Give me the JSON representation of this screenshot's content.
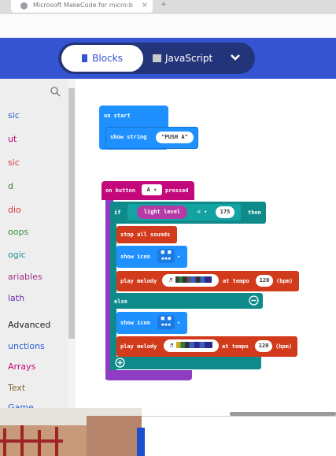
{
  "browser": {
    "tab_title": "Microsoft MakeCode for micro:b",
    "tab_close": "×",
    "new_tab": "+"
  },
  "header": {
    "blocks_label": "Blocks",
    "javascript_label": "JavaScript",
    "colors": {
      "header": "#3454d1",
      "toggle": "#24347a"
    }
  },
  "sidebar": {
    "categories": [
      {
        "label": "sic",
        "color": "#2f61d5"
      },
      {
        "label": "ut",
        "color": "#c3087c"
      },
      {
        "label": "sic",
        "color": "#d13b3b"
      },
      {
        "label": "d",
        "color": "#3b7a2d"
      },
      {
        "label": "dio",
        "color": "#d13b3b"
      },
      {
        "label": "oops",
        "color": "#3a8d3a"
      },
      {
        "label": "ogic",
        "color": "#1f8f8f"
      },
      {
        "label": "ariables",
        "color": "#a0308a"
      },
      {
        "label": "lath",
        "color": "#6d2fb3"
      },
      {
        "label": "Advanced",
        "color": "#222222"
      },
      {
        "label": "unctions",
        "color": "#2f61d5"
      },
      {
        "label": "Arrays",
        "color": "#c3087c"
      },
      {
        "label": "Text",
        "color": "#7a6a3a"
      },
      {
        "label": "Game",
        "color": "#2f61d5"
      }
    ]
  },
  "blocks": {
    "on_start": "on start",
    "show_string": "show string",
    "push_a": "\"PUSH A\"",
    "on_button": "on button",
    "button_value": "A ▾",
    "pressed": "pressed",
    "if_label": "if",
    "light_level": "light level",
    "operator": "< ▾",
    "threshold": "175",
    "then_label": "then",
    "stop_all_sounds": "stop all sounds",
    "show_icon": "show icon",
    "play_melody": "play melody",
    "at_tempo": "at tempo",
    "tempo": "120",
    "bpm": "(bpm)",
    "else_label": "else",
    "music_note": "♬",
    "colors": {
      "basic": "#1e90ff",
      "input": "#c3087c",
      "logic": "#0f8a8a",
      "music": "#d13b1b",
      "event": "#8f3bc2"
    }
  }
}
